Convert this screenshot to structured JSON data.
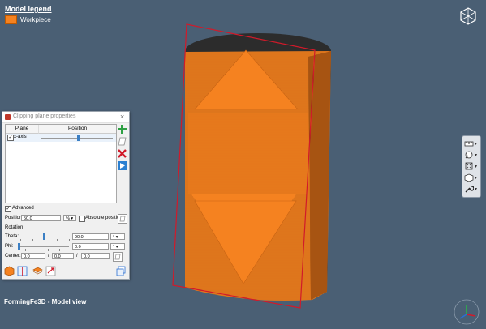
{
  "legend": {
    "title": "Model legend",
    "items": [
      {
        "label": "Workpiece",
        "color": "#f58220"
      }
    ]
  },
  "view_title": "FormingFe3D - Model view",
  "colors": {
    "background": "#4a5f74",
    "workpiece": "#f58220",
    "clip_frame": "#d11a2a",
    "accent": "#3b7fc4"
  },
  "toolbar": {
    "icons": [
      "ruler-icon",
      "probe-icon",
      "zoom-extents-icon",
      "view-cube-icon",
      "wrench-icon"
    ]
  },
  "dialog": {
    "title": "Clipping plane properties",
    "table": {
      "headers": [
        "Plane",
        "Position"
      ],
      "rows": [
        {
          "checked": true,
          "label": "x-axis",
          "position_fraction": 0.5
        }
      ]
    },
    "side_buttons": [
      "add-plane-icon",
      "plane-outline-icon",
      "delete-plane-icon",
      "play-icon"
    ],
    "advanced": {
      "checked": true,
      "label": "Advanced"
    },
    "position": {
      "label": "Position:",
      "value": "50.0",
      "unit": "%",
      "absolute_label": "Absolute position"
    },
    "rotation": {
      "label": "Rotation",
      "theta": {
        "label": "Theta:",
        "value": "90.0",
        "unit": "°",
        "fraction": 0.5
      },
      "phi": {
        "label": "Phi:",
        "value": "0.0",
        "unit": "°",
        "fraction": 0.0
      }
    },
    "center": {
      "label": "Center:",
      "x": "0.0",
      "y": "0.0",
      "z": "0.0",
      "sep": "/"
    }
  }
}
